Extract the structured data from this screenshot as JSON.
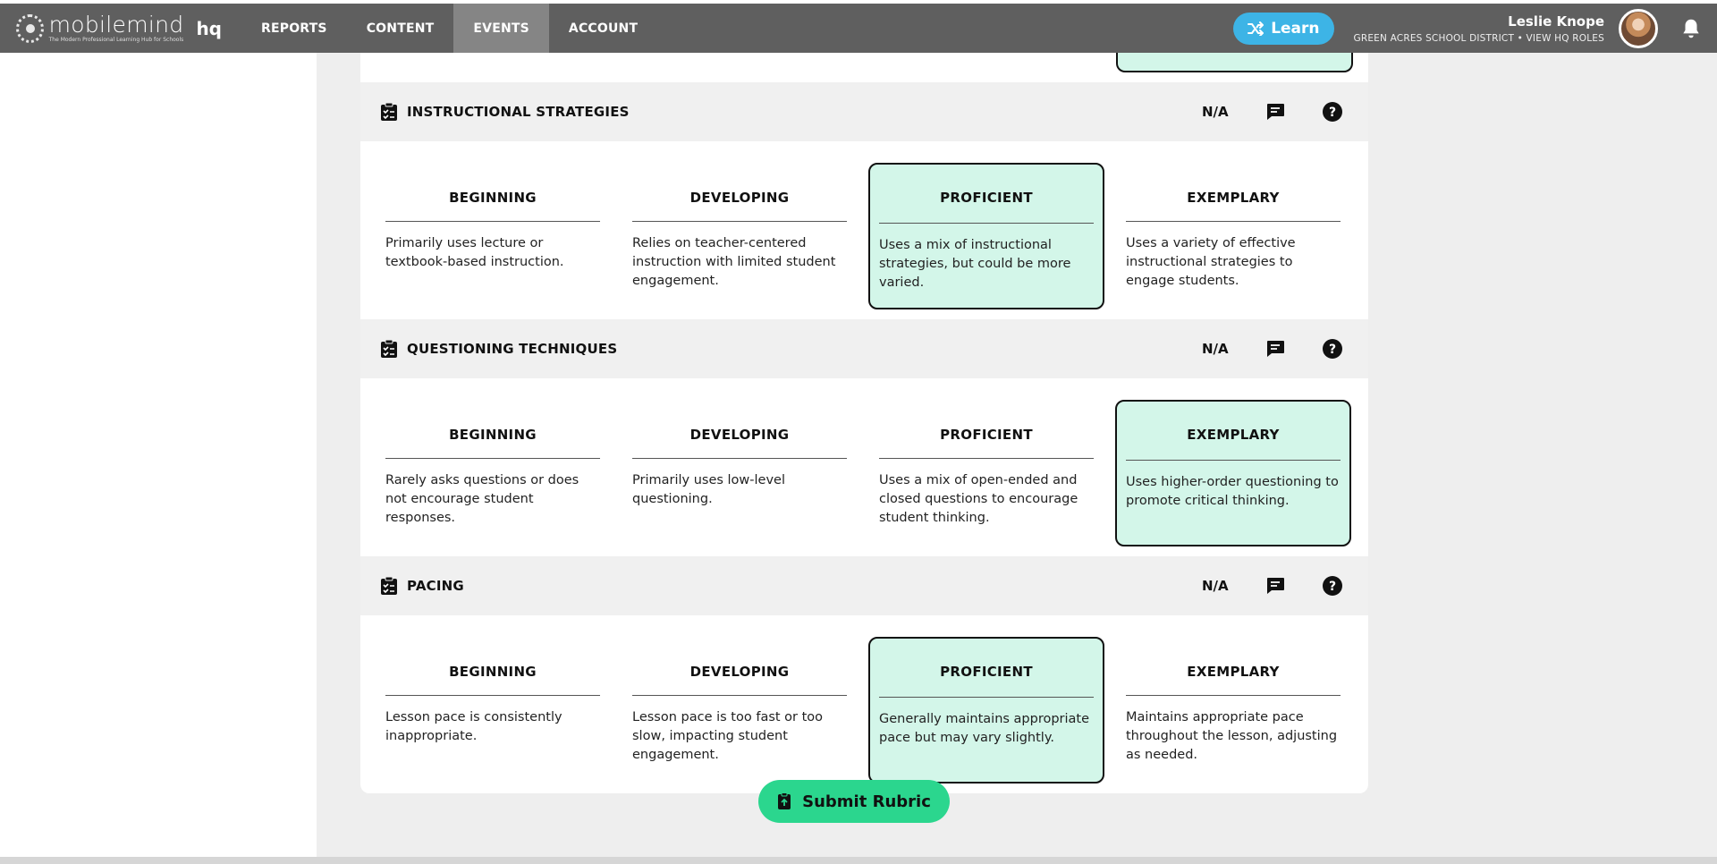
{
  "app": {
    "logo_name": "mobilemind",
    "logo_tagline": "The Modern Professional Learning Hub for Schools",
    "logo_suffix": "hq"
  },
  "nav": {
    "items": [
      {
        "label": "REPORTS",
        "active": false
      },
      {
        "label": "CONTENT",
        "active": false
      },
      {
        "label": "EVENTS",
        "active": true
      },
      {
        "label": "ACCOUNT",
        "active": false
      }
    ],
    "learn_label": "Learn"
  },
  "user": {
    "name": "Leslie Knope",
    "org": "GREEN ACRES SCHOOL DISTRICT • VIEW HQ ROLES"
  },
  "colors": {
    "topbar": "#5f5f5f",
    "nav_active": "#858585",
    "learn": "#3db4e6",
    "selected_level": "#d3f6e9",
    "submit": "#2bd68e"
  },
  "criteria": [
    {
      "title": "INSTRUCTIONAL STRATEGIES",
      "na_label": "N/A",
      "selected": 2,
      "levels": [
        {
          "title": "BEGINNING",
          "desc": "Primarily uses lecture or textbook-based instruction."
        },
        {
          "title": "DEVELOPING",
          "desc": "Relies on teacher-centered instruction with limited student engagement."
        },
        {
          "title": "PROFICIENT",
          "desc": "Uses a mix of instructional strategies, but could be more varied."
        },
        {
          "title": "EXEMPLARY",
          "desc": "Uses a variety of effective instructional strategies to engage students."
        }
      ]
    },
    {
      "title": "QUESTIONING TECHNIQUES",
      "na_label": "N/A",
      "selected": 3,
      "levels": [
        {
          "title": "BEGINNING",
          "desc": "Rarely asks questions or does not encourage student responses."
        },
        {
          "title": "DEVELOPING",
          "desc": "Primarily uses low-level questioning."
        },
        {
          "title": "PROFICIENT",
          "desc": "Uses a mix of open-ended and closed questions to encourage student thinking."
        },
        {
          "title": "EXEMPLARY",
          "desc": "Uses higher-order questioning to promote critical thinking."
        }
      ]
    },
    {
      "title": "PACING",
      "na_label": "N/A",
      "selected": 2,
      "levels": [
        {
          "title": "BEGINNING",
          "desc": "Lesson pace is consistently inappropriate."
        },
        {
          "title": "DEVELOPING",
          "desc": "Lesson pace is too fast or too slow, impacting student engagement."
        },
        {
          "title": "PROFICIENT",
          "desc": "Generally maintains appropriate pace but may vary slightly."
        },
        {
          "title": "EXEMPLARY",
          "desc": "Maintains appropriate pace throughout the lesson, adjusting as needed."
        }
      ]
    }
  ],
  "submit_label": "Submit Rubric"
}
